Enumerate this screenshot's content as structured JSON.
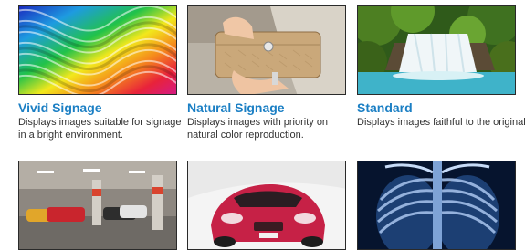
{
  "modes": [
    {
      "id": "vivid-signage",
      "title": "Vivid Signage",
      "description": "Displays images suitable for signage in a bright environment.",
      "image_icon": "rainbow-wave-image"
    },
    {
      "id": "natural-signage",
      "title": "Natural Signage",
      "description": "Displays images with priority on natural color reproduction.",
      "image_icon": "handbag-image"
    },
    {
      "id": "standard",
      "title": "Standard",
      "description": "Displays images faithful to the original.",
      "image_icon": "waterfall-image"
    },
    {
      "id": "row2-col1",
      "image_icon": "parking-garage-image"
    },
    {
      "id": "row2-col2",
      "image_icon": "red-car-image"
    },
    {
      "id": "row2-col3",
      "image_icon": "chest-xray-image"
    }
  ],
  "colors": {
    "title": "#1b7fc4",
    "text": "#333333"
  }
}
